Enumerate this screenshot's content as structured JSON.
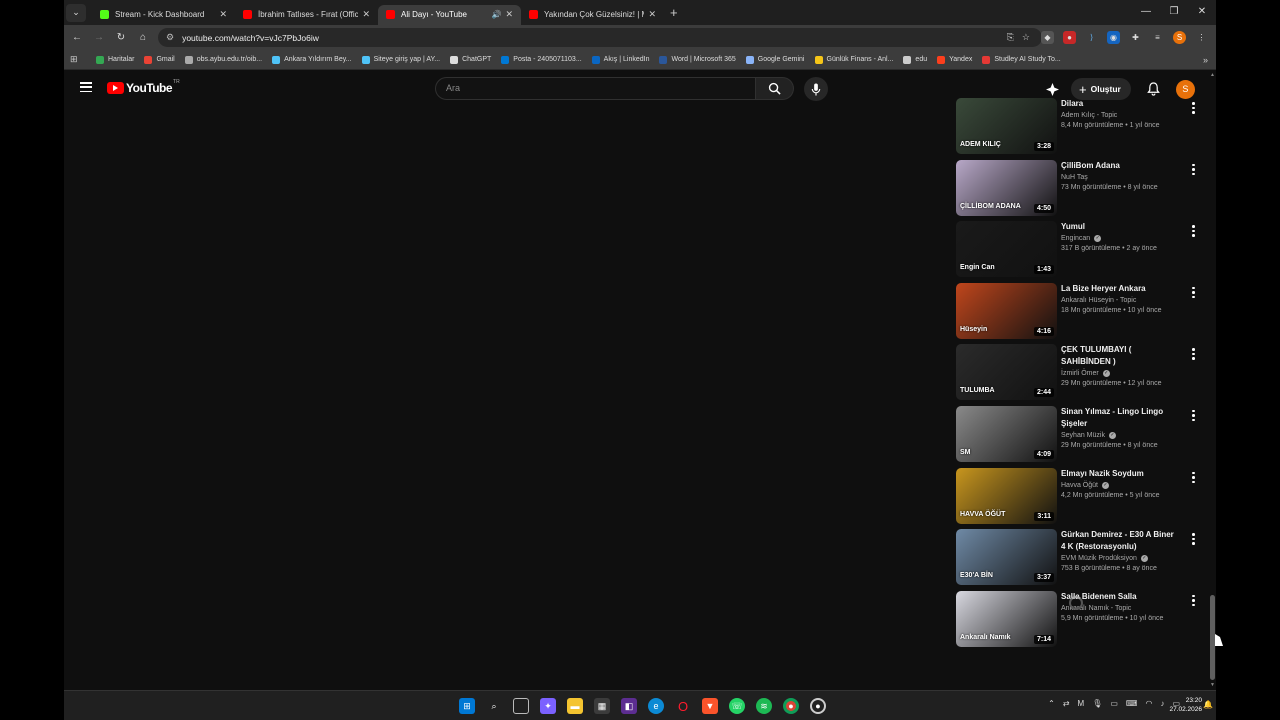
{
  "browser": {
    "tabs": [
      {
        "title": "Stream - Kick Dashboard",
        "favicon_color": "#53fc18",
        "active": false
      },
      {
        "title": "İbrahim Tatlıses - Fırat (Official",
        "favicon_color": "#ff0000",
        "active": false
      },
      {
        "title": "Ali Dayı - YouTube",
        "favicon_color": "#ff0000",
        "active": true
      },
      {
        "title": "Yakından Çok Güzelsiniz! | Mani",
        "favicon_color": "#ff0000",
        "active": false
      }
    ],
    "url": "youtube.com/watch?v=vJc7PbJo6iw",
    "bookmarks": [
      {
        "label": "Haritalar",
        "color": "#34a853"
      },
      {
        "label": "Gmail",
        "color": "#ea4335"
      },
      {
        "label": "obs.aybu.edu.tr/oib...",
        "color": "#aaaaaa"
      },
      {
        "label": "Ankara Yıldırım Bey...",
        "color": "#4fc3f7"
      },
      {
        "label": "Siteye giriş yap | AY...",
        "color": "#4fc3f7"
      },
      {
        "label": "ChatGPT",
        "color": "#dddddd"
      },
      {
        "label": "Posta - 2405071103...",
        "color": "#0078d4"
      },
      {
        "label": "Akış | LinkedIn",
        "color": "#0a66c2"
      },
      {
        "label": "Word | Microsoft 365",
        "color": "#2b579a"
      },
      {
        "label": "Google Gemini",
        "color": "#8ab4f8"
      },
      {
        "label": "Günlük Finans - Anl...",
        "color": "#f5c518"
      },
      {
        "label": "edu",
        "color": "#cccccc"
      },
      {
        "label": "Yandex",
        "color": "#fc3f1d"
      },
      {
        "label": "Studley AI Study To...",
        "color": "#e53935"
      }
    ]
  },
  "youtube": {
    "logo_text": "YouTube",
    "region": "TR",
    "search_placeholder": "Ara",
    "create_label": "Oluştur",
    "avatar_letter": "S",
    "recommendations": [
      {
        "title": "Dilara",
        "channel": "Adem Kılıç - Topic",
        "verified": false,
        "stats": "8,4 Mn görüntüleme • 1 yıl önce",
        "duration": "3:28",
        "thumb_color": "#3a4a3a",
        "thumb_text": "ADEM KILIÇ"
      },
      {
        "title": "ÇilliBom Adana",
        "channel": "NuH Taş",
        "verified": false,
        "stats": "73 Mn görüntüleme • 8 yıl önce",
        "duration": "4:50",
        "thumb_color": "#b8a8c8",
        "thumb_text": "ÇİLLİBOM ADANA"
      },
      {
        "title": "Yumul",
        "channel": "Engincan",
        "verified": true,
        "stats": "317 B görüntüleme • 2 ay önce",
        "duration": "1:43",
        "thumb_color": "#1a1a1a",
        "thumb_text": "Engin Can"
      },
      {
        "title": "La Bize Heryer Ankara",
        "channel": "Ankaralı Hüseyin - Topic",
        "verified": false,
        "stats": "18 Mn görüntüleme • 10 yıl önce",
        "duration": "4:16",
        "thumb_color": "#c0461c",
        "thumb_text": "Hüseyin"
      },
      {
        "title": "ÇEK TULUMBAYI ( SAHİBİNDEN )",
        "channel": "İzmirli Ömer",
        "verified": true,
        "stats": "29 Mn görüntüleme • 12 yıl önce",
        "duration": "2:44",
        "thumb_color": "#2b2b2b",
        "thumb_text": "TULUMBA"
      },
      {
        "title": "Sinan Yılmaz - Lingo Lingo Şişeler",
        "channel": "Seyhan Müzik",
        "verified": true,
        "stats": "29 Mn görüntüleme • 8 yıl önce",
        "duration": "4:09",
        "thumb_color": "#8a8a8a",
        "thumb_text": "SM"
      },
      {
        "title": "Elmayı Nazik Soydum",
        "channel": "Havva Öğüt",
        "verified": true,
        "stats": "4,2 Mn görüntüleme • 5 yıl önce",
        "duration": "3:11",
        "thumb_color": "#c8961e",
        "thumb_text": "HAVVA ÖĞÜT"
      },
      {
        "title": "Gürkan Demirez - E30 A Biner 4 K (Restorasyonlu)",
        "channel": "EVM Müzik Prodüksiyon",
        "verified": true,
        "stats": "753 B görüntüleme • 8 ay önce",
        "duration": "3:37",
        "thumb_color": "#6f8aa6",
        "thumb_text": "E30'A BİN"
      },
      {
        "title": "Salla Bidenem Salla",
        "channel": "Ankaralı Namık - Topic",
        "verified": false,
        "stats": "5,9 Mn görüntüleme • 10 yıl önce",
        "duration": "7:14",
        "thumb_color": "#d8d8e0",
        "thumb_text": "Ankaralı Namık"
      }
    ]
  },
  "taskbar": {
    "time": "23:20",
    "date": "27.02.2026"
  }
}
